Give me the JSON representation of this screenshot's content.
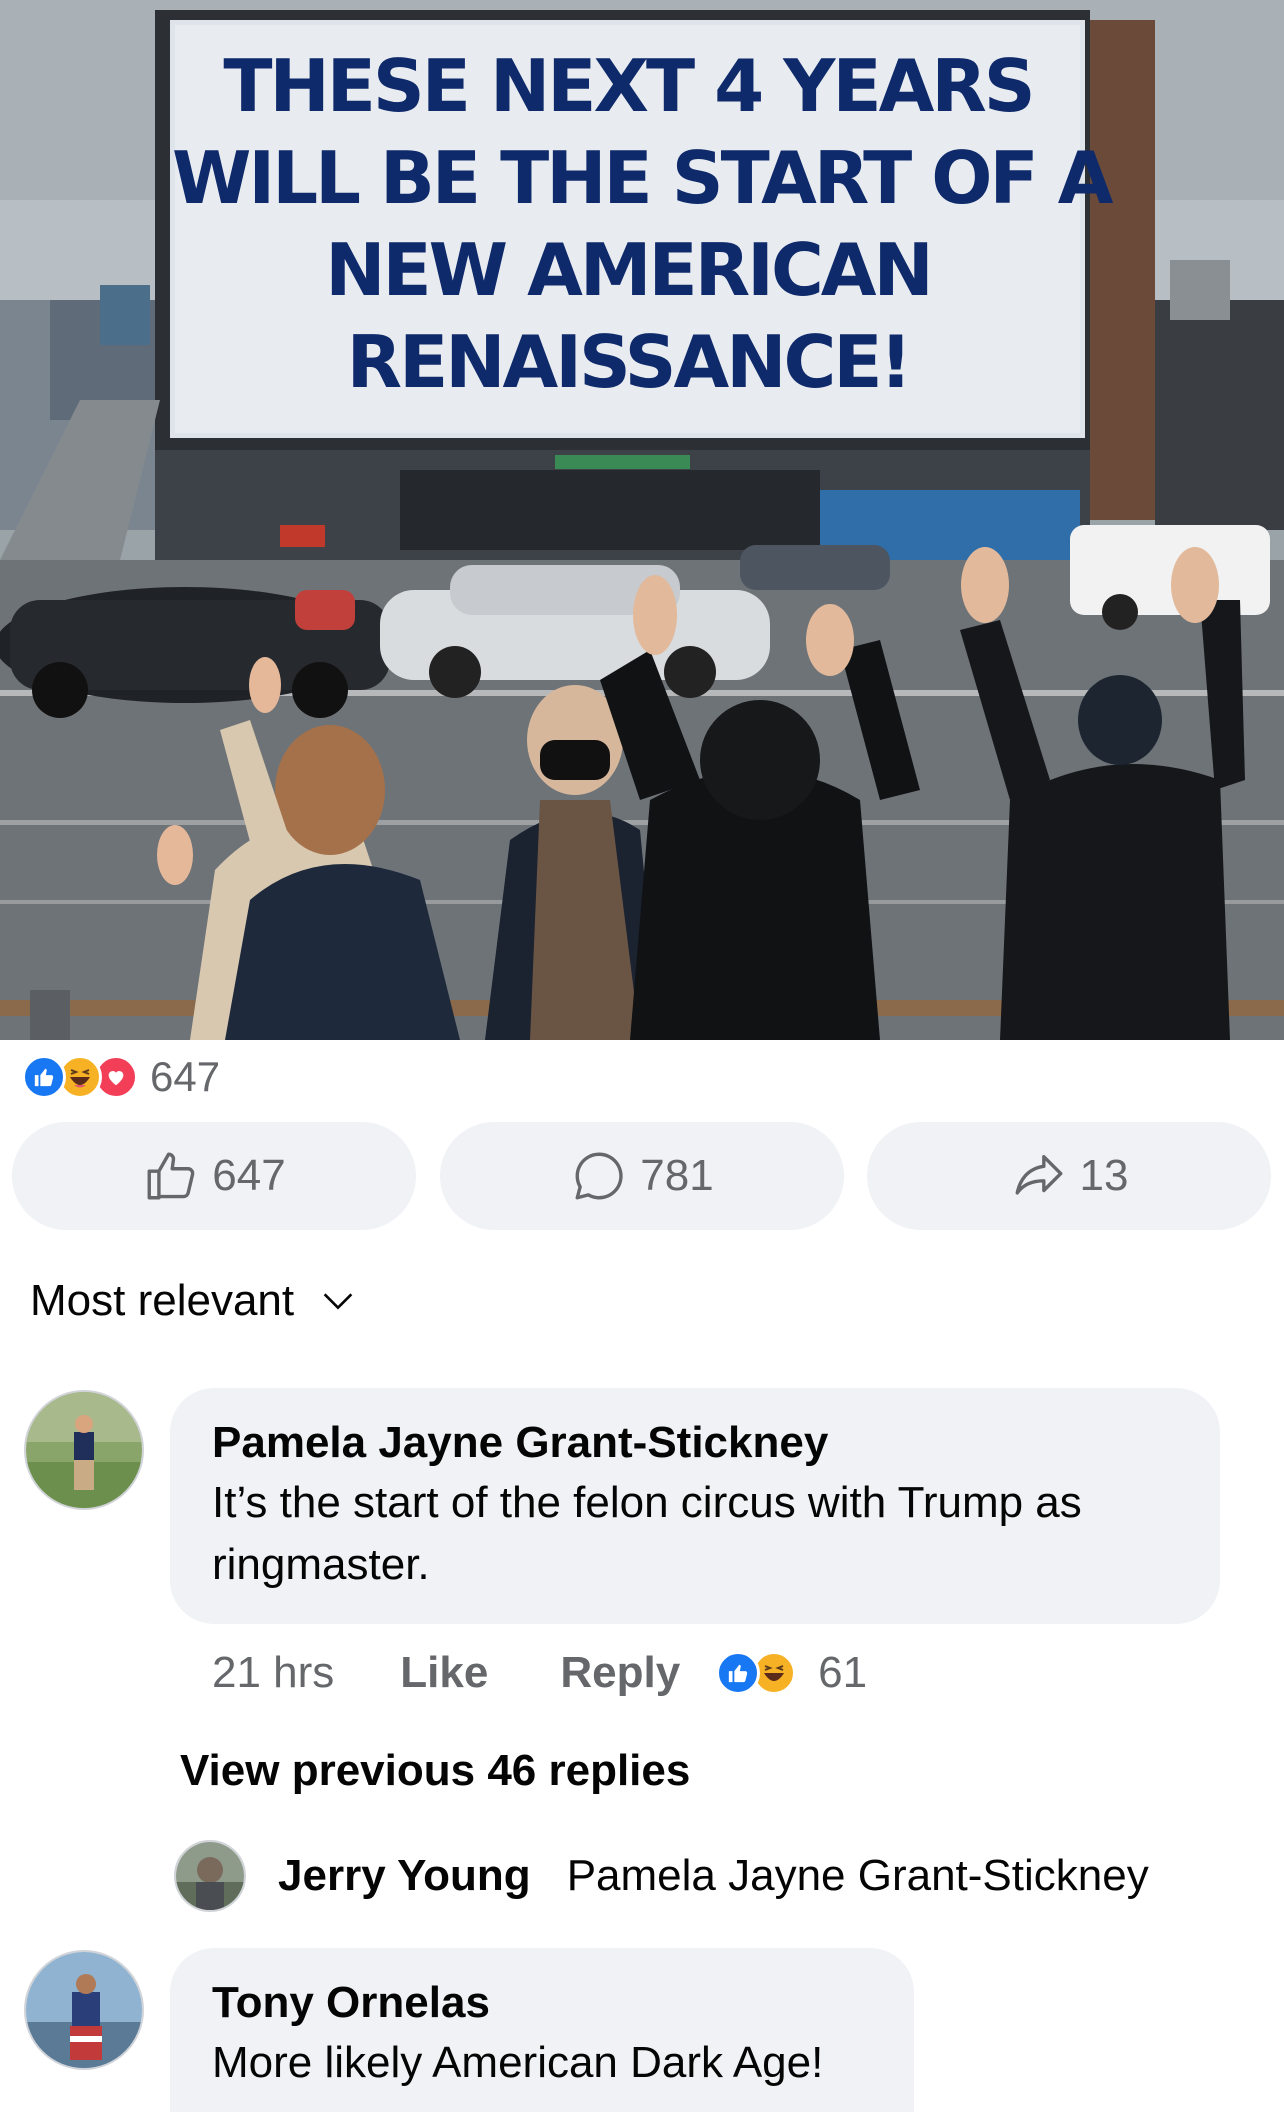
{
  "post": {
    "image": {
      "billboard_lines": [
        "THESE NEXT 4 YEARS",
        "WILL BE THE START OF A",
        "NEW AMERICAN",
        "RENAISSANCE!"
      ]
    },
    "reactions": {
      "types": [
        "like-icon",
        "haha-icon",
        "love-icon"
      ],
      "count": "647"
    },
    "actions": {
      "like_count": "647",
      "comment_count": "781",
      "share_count": "13"
    }
  },
  "comments_section": {
    "sort_label": "Most relevant"
  },
  "comments": [
    {
      "author": "Pamela Jayne Grant-Stickney",
      "text": "It’s the start of the felon circus with Trump as ringmaster.",
      "time": "21 hrs",
      "like_label": "Like",
      "reply_label": "Reply",
      "reaction_count": "61",
      "view_previous": "View previous 46 replies",
      "reply_preview": {
        "author": "Jerry Young",
        "text": "Pamela Jayne Grant-Stickney"
      }
    },
    {
      "author": "Tony Ornelas",
      "text": "More likely American Dark Age!"
    }
  ],
  "colors": {
    "accent": "#1877f2",
    "bubble": "#f0f2f5",
    "secondary_text": "#65676b",
    "billboard_text": "#0f2a6b"
  }
}
